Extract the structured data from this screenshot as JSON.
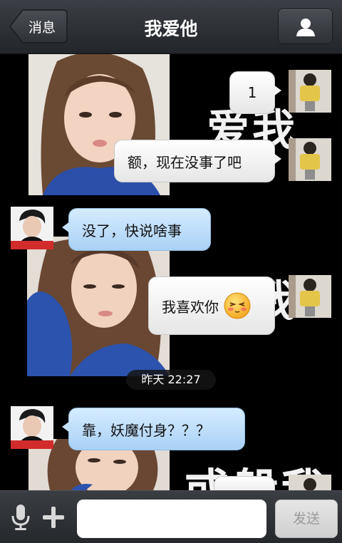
{
  "header": {
    "back_label": "消息",
    "title": "我爱他"
  },
  "messages": {
    "out_1": "1",
    "out_2": "额，现在没事了吧",
    "in_1": "没了，快说啥事",
    "out_3": "我喜欢你",
    "timestamp": "昨天 22:27",
    "in_2": "靠，妖魔付身？？？"
  },
  "background_text": {
    "line_1": "爱我",
    "line_2": "我",
    "line_3": "或般我"
  },
  "input": {
    "placeholder": "",
    "send_label": "发送"
  },
  "icons": {
    "back": "back-arrow-icon",
    "contact": "person-icon",
    "voice": "microphone-icon",
    "more": "plus-icon",
    "emoji": "blushing-emoji-icon"
  },
  "colors": {
    "incoming_bubble": "#b9dcf9",
    "outgoing_bubble": "#f2f2f2",
    "header_bg": "#2e3136"
  }
}
